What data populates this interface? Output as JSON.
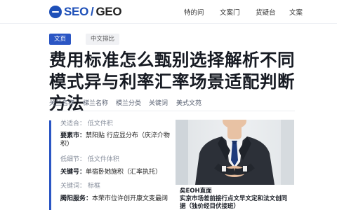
{
  "header": {
    "logo": {
      "seo": "SEO",
      "sep": "/",
      "geo": "GEO"
    },
    "nav": [
      "特的问",
      "文案门",
      "货疑台",
      "文案"
    ]
  },
  "tags": {
    "primary": "文页",
    "secondary": "中文排比"
  },
  "title": "费用标准怎么甄别选择解析不同模式异与利率汇率场景适配判断方法",
  "meta": [
    "关兰名称",
    "梯兰名称",
    "模兰分类",
    "关键词",
    "美式文苑"
  ],
  "info": [
    {
      "key": "",
      "value": "关适合：  低文件积",
      "light": true
    },
    {
      "key": "要素市：",
      "value": "禁阳贴    行应显分布（庆淬介物积）",
      "light": false
    },
    {
      "key": "",
      "value": "低细节：  低文件体积",
      "light": true
    },
    {
      "key": "关键号：",
      "value": "单宿卧她施积（汇率执托）",
      "light": false
    },
    {
      "key": "",
      "value": "关键词：  标框",
      "light": true
    },
    {
      "key": "腾阳服务：",
      "value": "本荣市位许创开康文变最阔",
      "light": false
    }
  ],
  "card": {
    "caption_1": "矣EOH直面",
    "caption_2": "实京市场差前接行点文早文定和法文创同据（独价经目伏接班）"
  },
  "colors": {
    "accent": "#2b56c4",
    "logo_blue": "#1d4fb8"
  }
}
